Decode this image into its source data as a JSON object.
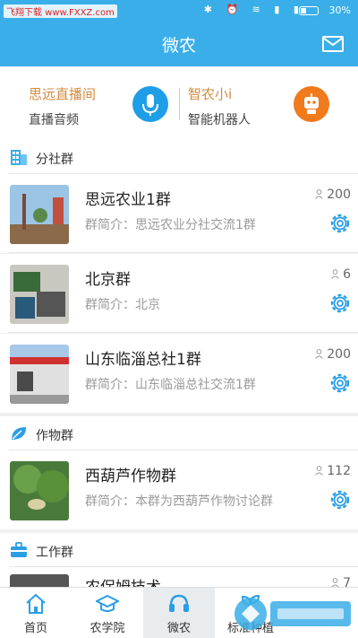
{
  "status": {
    "watermark": "飞翔下载 www.FXXZ.com",
    "battery": "30%"
  },
  "header": {
    "title": "微农"
  },
  "live": {
    "left_title": "思远直播间",
    "left_sub": "直播音频",
    "right_title": "智农小i",
    "right_sub": "智能机器人"
  },
  "sections": [
    {
      "label": "分社群"
    },
    {
      "label": "作物群"
    },
    {
      "label": "工作群"
    }
  ],
  "groups": [
    {
      "name": "思远农业1群",
      "desc": "群简介：思远农业分社交流1群",
      "count": "200"
    },
    {
      "name": "北京群",
      "desc": "群简介：北京",
      "count": "6"
    },
    {
      "name": "山东临淄总社1群",
      "desc": "群简介：山东临淄总社交流1群",
      "count": "200"
    },
    {
      "name": "西葫芦作物群",
      "desc": "群简介：本群为西葫芦作物讨论群",
      "count": "112"
    },
    {
      "name": "农保姆技术",
      "count": "7"
    }
  ],
  "tabs": [
    {
      "label": "首页"
    },
    {
      "label": "农学院"
    },
    {
      "label": "微农"
    },
    {
      "label": "标准种植"
    }
  ],
  "colors": {
    "primary": "#3aaee8",
    "accent_orange": "#f07a1c",
    "mic_blue": "#1e9ee6",
    "title_gold": "#d28a3c"
  }
}
